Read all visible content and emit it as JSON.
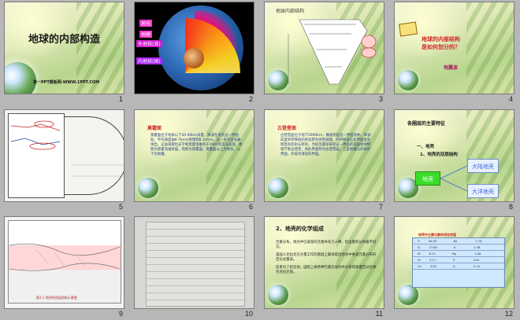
{
  "slides": [
    {
      "number": "1",
      "title": "地球的内部构造",
      "url": "第一PPT模板网-WWW.1PPT.COM"
    },
    {
      "number": "2",
      "labels": [
        "地壳",
        "地幔",
        "外地核(液)",
        "内地核(固)"
      ]
    },
    {
      "number": "3",
      "header": "地球内部结构"
    },
    {
      "number": "4",
      "question_line1": "地球的内部结构",
      "question_line2": "是如何划分的？",
      "answer": "地震波"
    },
    {
      "number": "5"
    },
    {
      "number": "6",
      "card_title": "莫霍面",
      "body": "莫霍面位于地表以下30-40km深度，纵波在地壳这一界面处，平均速度由6-7km/s突增到8.1km/s，这一变化首先被测出。这由南斯拉夫学者莫霍洛维奇于1909年首先发现，故称为莫霍洛维奇面，简称为莫霍面。莫霍面以上为地壳，以下为地幔。"
    },
    {
      "number": "7",
      "card_title": "古登堡面",
      "body": "古登堡面位于地下2900km，横波到达这一界面消失，纵波向里突然降低的状态转为突然减速。同时纵波在此界面发生明显的反射与折射。为纪念最早研究这一界面的美国地球物理学家古登堡，将此界面称为古登堡面。它是地幔与外核的界面，外核为液态的界面。"
    },
    {
      "number": "8",
      "header": "各圈层的主要特征",
      "line1": "一、地壳",
      "line2": "1、地壳的双层结构",
      "box_crust": "地壳",
      "box_continental": "大陆地壳",
      "box_oceanic": "大洋地壳"
    },
    {
      "number": "9",
      "caption": "图1-1 地壳的双层结构示意图"
    },
    {
      "number": "10"
    },
    {
      "number": "11",
      "header": "2、地壳的化学组成",
      "bullets": [
        "元素分布。地壳中已发现的元素共有几十种，但含量的分布极不均匀。",
        "美国人克拉克在大量工作的基础上最早提出地壳中各类元素分布的百分含量表。",
        "后来为了纪念他，国际上将各种元素在地壳中分布的质量百分比称为克拉克值。"
      ]
    },
    {
      "number": "12",
      "table_caption": "地壳中主要元素的克拉克值",
      "rows": [
        [
          "O",
          "46.95",
          "Na",
          "2.78"
        ],
        [
          "Si",
          "27.88",
          "K",
          "2.58"
        ],
        [
          "Al",
          "8.13",
          "Mg",
          "2.06"
        ],
        [
          "Fe",
          "5.17",
          "Ti",
          "0.62"
        ],
        [
          "Ca",
          "3.65",
          "H",
          "0.14"
        ]
      ]
    }
  ],
  "colors": {
    "accent_red": "#d12a2a",
    "body_blue": "#1f3b8c",
    "selection": "#f0a000",
    "crust_green": "#3bdc2a",
    "box_blue": "#3b6bd6"
  }
}
